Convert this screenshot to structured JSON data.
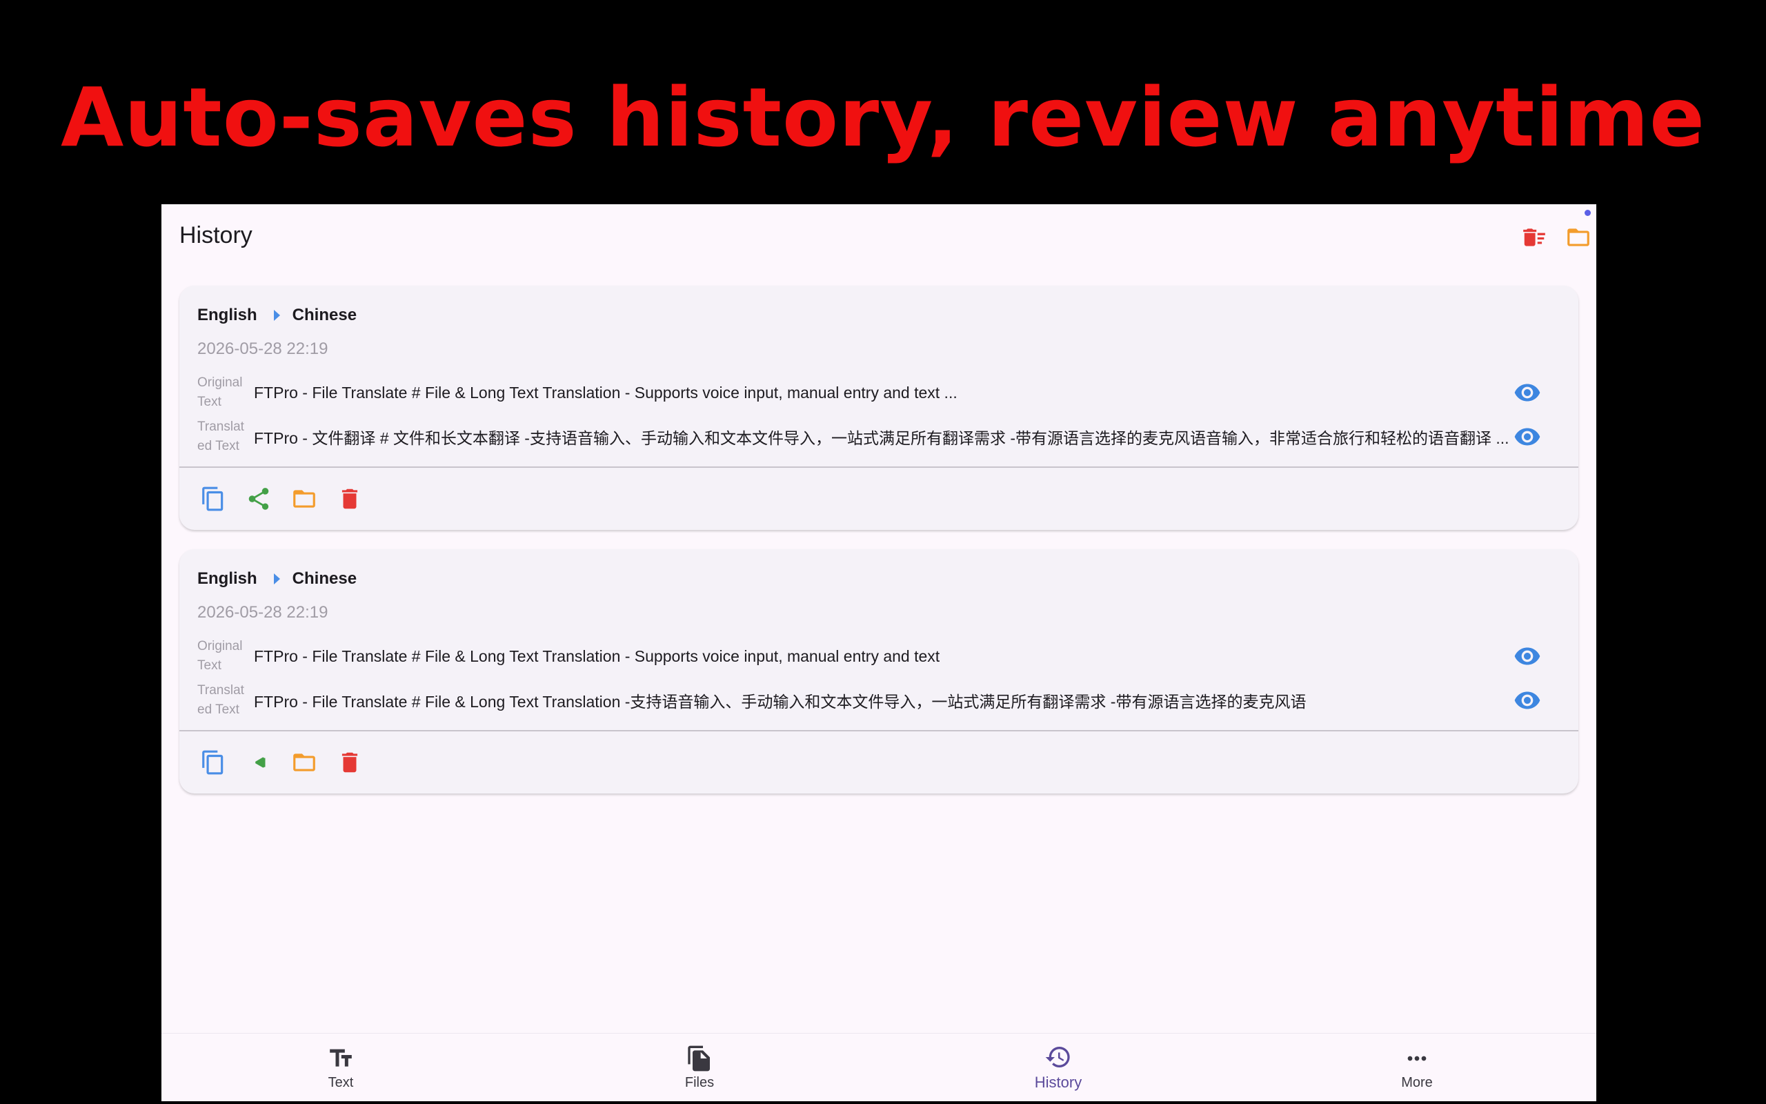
{
  "banner": {
    "text": "Auto-saves history, review anytime"
  },
  "appbar": {
    "title": "History",
    "actions": [
      {
        "icon": "delete-sweep-icon",
        "color": "#e53935"
      },
      {
        "icon": "folder-icon",
        "color": "#f39c2c"
      }
    ]
  },
  "labels": {
    "original": "Original Text",
    "translated": "Translated Text"
  },
  "records": [
    {
      "source_lang": "English",
      "target_lang": "Chinese",
      "timestamp": "2026-05-28 22:19",
      "original_label_line1": "Original",
      "original_label_line2": "Text",
      "translated_label_line1": "Translat",
      "translated_label_line2": "ed Text",
      "original_text": "FTPro - File Translate # File & Long Text Translation - Supports voice input, manual entry and text ...",
      "translated_text": "FTPro - 文件翻译 # 文件和长文本翻译 -支持语音输入、手动输入和文本文件导入，一站式满足所有翻译需求 -带有源语言选择的麦克风语音输入，非常适合旅行和轻松的语音翻译 ..."
    },
    {
      "source_lang": "English",
      "target_lang": "Chinese",
      "timestamp": "2026-05-28 22:19",
      "original_label_line1": "Original",
      "original_label_line2": "Text",
      "translated_label_line1": "Translat",
      "translated_label_line2": "ed Text",
      "original_text": "FTPro - File Translate # File & Long Text Translation - Supports voice input, manual entry and text",
      "translated_text": "FTPro - File Translate # File & Long Text Translation -支持语音输入、手动输入和文本文件导入，一站式满足所有翻译需求 -带有源语言选择的麦克风语"
    }
  ],
  "card_actions": [
    {
      "icon": "copy-icon",
      "color": "#4a8ee6"
    },
    {
      "icon": "share-icon",
      "color": "#43a047"
    },
    {
      "icon": "folder-icon",
      "color": "#f39c2c"
    },
    {
      "icon": "delete-icon",
      "color": "#e53935"
    }
  ],
  "colors": {
    "eye": "#3d86e0",
    "active_nav": "#5b4a9b",
    "banner": "#f01010"
  },
  "bottom_nav": [
    {
      "label": "Text",
      "icon": "text-fields-icon",
      "active": false
    },
    {
      "label": "Files",
      "icon": "files-icon",
      "active": false
    },
    {
      "label": "History",
      "icon": "history-icon",
      "active": true
    },
    {
      "label": "More",
      "icon": "more-horiz-icon",
      "active": false
    }
  ]
}
